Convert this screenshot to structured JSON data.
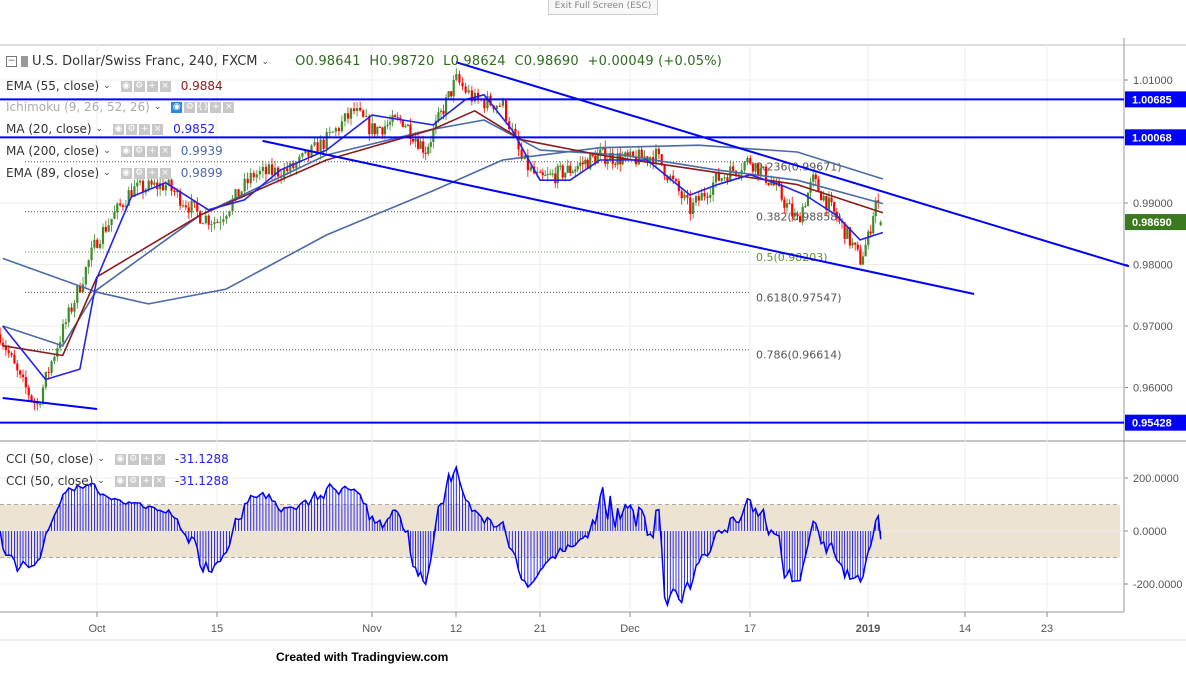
{
  "window": {
    "exit_fullscreen_label": "Exit Full Screen (ESC)"
  },
  "header": {
    "symbol_title": "U.S. Dollar/Swiss Franc, 240, FXCM",
    "open": "O0.98641",
    "high": "H0.98720",
    "low": "L0.98624",
    "close": "C0.98690",
    "change": "+0.00049 (+0.05%)"
  },
  "indicators": [
    {
      "label": "EMA (55, close)",
      "value": "0.9884",
      "color": "#8b1a1a"
    },
    {
      "label": "Ichimoku (9, 26, 52, 26)",
      "value": "",
      "color": "#999999",
      "hidden": true
    },
    {
      "label": "MA (20, close)",
      "value": "0.9852",
      "color": "#2222ee"
    },
    {
      "label": "MA (200, close)",
      "value": "0.9939",
      "color": "#4a6aa8"
    },
    {
      "label": "EMA (89, close)",
      "value": "0.9899",
      "color": "#4a6aa8"
    }
  ],
  "cci_indicators": [
    {
      "label": "CCI (50, close)",
      "value": "-31.1288"
    },
    {
      "label": "CCI (50, close)",
      "value": "-31.1288"
    }
  ],
  "footer": {
    "text": "Created with Tradingview.com"
  },
  "chart_data": {
    "type": "candlestick",
    "title": "U.S. Dollar/Swiss Franc, 240, FXCM",
    "ylim": [
      0.9529,
      1.0156
    ],
    "grid": true,
    "colors": {
      "up": "#3f8a2a",
      "down": "#ff0000",
      "hline": "#0000ff",
      "last_price": "#3a7a1e"
    },
    "last_bar": {
      "open": 0.98641,
      "high": 0.9872,
      "low": 0.98624,
      "close": 0.9869
    },
    "price_path": [
      [
        "2018-09-20",
        0.9677
      ],
      [
        "2018-09-22",
        0.9613
      ],
      [
        "2018-09-24",
        0.957
      ],
      [
        "2018-09-26",
        0.9655
      ],
      [
        "2018-10-01",
        0.984
      ],
      [
        "2018-10-05",
        0.9921
      ],
      [
        "2018-10-09",
        0.993
      ],
      [
        "2018-10-13",
        0.988
      ],
      [
        "2018-10-15",
        0.987
      ],
      [
        "2018-10-19",
        0.9946
      ],
      [
        "2018-10-23",
        0.9954
      ],
      [
        "2018-10-27",
        1.0002
      ],
      [
        "2018-10-30",
        1.005
      ],
      [
        "2018-11-01",
        1.0019
      ],
      [
        "2018-11-05",
        1.0035
      ],
      [
        "2018-11-08",
        0.9986
      ],
      [
        "2018-11-12",
        1.01
      ],
      [
        "2018-11-14",
        1.0067
      ],
      [
        "2018-11-17",
        1.006
      ],
      [
        "2018-11-19",
        0.997
      ],
      [
        "2018-11-21",
        0.9937
      ],
      [
        "2018-11-25",
        0.9954
      ],
      [
        "2018-11-29",
        0.9978
      ],
      [
        "2018-12-03",
        0.997
      ],
      [
        "2018-12-06",
        0.9978
      ],
      [
        "2018-12-10",
        0.9889
      ],
      [
        "2018-12-13",
        0.9937
      ],
      [
        "2018-12-17",
        0.997
      ],
      [
        "2018-12-20",
        0.9929
      ],
      [
        "2018-12-23",
        0.987
      ],
      [
        "2018-12-25",
        0.9937
      ],
      [
        "2018-12-29",
        0.9856
      ],
      [
        "2018-12-31",
        0.9807
      ],
      [
        "2019-01-01",
        0.984
      ],
      [
        "2019-01-02",
        0.9905
      ],
      [
        "2019-01-03",
        0.9869
      ]
    ],
    "series": [
      {
        "name": "MA (200, close)",
        "color": "#4a6aa8",
        "points": [
          [
            "2018-09-20",
            0.981
          ],
          [
            "2018-10-01",
            0.9755
          ],
          [
            "2018-10-07",
            0.9736
          ],
          [
            "2018-10-16",
            0.976
          ],
          [
            "2018-10-27",
            0.9848
          ],
          [
            "2018-11-09",
            0.992
          ],
          [
            "2018-11-17",
            0.997
          ],
          [
            "2018-11-29",
            0.999
          ],
          [
            "2018-12-11",
            0.9994
          ],
          [
            "2018-12-23",
            0.9983
          ],
          [
            "2019-01-03",
            0.9939
          ]
        ]
      },
      {
        "name": "EMA (89, close)",
        "color": "#4a6aa8",
        "points": [
          [
            "2018-09-20",
            0.97
          ],
          [
            "2018-09-27",
            0.9668
          ],
          [
            "2018-10-01",
            0.9759
          ],
          [
            "2018-10-13",
            0.988
          ],
          [
            "2018-10-27",
            0.9978
          ],
          [
            "2018-11-09",
            1.002
          ],
          [
            "2018-11-15",
            1.0035
          ],
          [
            "2018-11-21",
            0.9986
          ],
          [
            "2018-12-02",
            0.9978
          ],
          [
            "2018-12-13",
            0.9954
          ],
          [
            "2018-12-23",
            0.9937
          ],
          [
            "2019-01-03",
            0.9899
          ]
        ]
      },
      {
        "name": "EMA (55, close)",
        "color": "#8b1a1a",
        "points": [
          [
            "2018-09-20",
            0.9668
          ],
          [
            "2018-09-27",
            0.9652
          ],
          [
            "2018-10-01",
            0.978
          ],
          [
            "2018-10-13",
            0.988
          ],
          [
            "2018-10-27",
            0.997
          ],
          [
            "2018-11-09",
            1.002
          ],
          [
            "2018-11-14",
            1.005
          ],
          [
            "2018-11-19",
            1.0003
          ],
          [
            "2018-11-29",
            0.9978
          ],
          [
            "2018-12-11",
            0.9954
          ],
          [
            "2018-12-23",
            0.993
          ],
          [
            "2019-01-03",
            0.9884
          ]
        ]
      },
      {
        "name": "MA (20, close)",
        "color": "#2222ee",
        "points": [
          [
            "2018-09-20",
            0.97
          ],
          [
            "2018-09-25",
            0.9613
          ],
          [
            "2018-09-29",
            0.963
          ],
          [
            "2018-10-01",
            0.9778
          ],
          [
            "2018-10-05",
            0.991
          ],
          [
            "2018-10-09",
            0.9933
          ],
          [
            "2018-10-14",
            0.9889
          ],
          [
            "2018-10-18",
            0.9905
          ],
          [
            "2018-10-22",
            0.9954
          ],
          [
            "2018-10-27",
            0.9986
          ],
          [
            "2018-11-01",
            1.0043
          ],
          [
            "2018-11-05",
            1.0035
          ],
          [
            "2018-11-09",
            1.0027
          ],
          [
            "2018-11-13",
            1.0068
          ],
          [
            "2018-11-15",
            1.0076
          ],
          [
            "2018-11-18",
            1.0019
          ],
          [
            "2018-11-21",
            0.9937
          ],
          [
            "2018-11-25",
            0.9937
          ],
          [
            "2018-11-29",
            0.997
          ],
          [
            "2018-12-05",
            0.997
          ],
          [
            "2018-12-10",
            0.9913
          ],
          [
            "2018-12-13",
            0.9929
          ],
          [
            "2018-12-17",
            0.9946
          ],
          [
            "2018-12-21",
            0.9929
          ],
          [
            "2018-12-24",
            0.9913
          ],
          [
            "2018-12-28",
            0.988
          ],
          [
            "2018-12-31",
            0.984
          ],
          [
            "2019-01-03",
            0.9852
          ]
        ]
      }
    ],
    "horizontal_lines": [
      1.00685,
      1.00068,
      0.95428
    ],
    "trendlines": [
      [
        [
          "2018-11-12",
          1.0129
        ],
        [
          "2019-02-01",
          0.9797
        ]
      ],
      [
        [
          "2018-10-20",
          1.0001
        ],
        [
          "2019-01-15",
          0.9752
        ]
      ],
      [
        [
          "2018-09-20",
          0.9583
        ],
        [
          "2018-10-01",
          0.9565
        ]
      ]
    ],
    "fibonacci": [
      {
        "label": "0.236(0.99671)",
        "price": 0.99671,
        "color": "#555555"
      },
      {
        "label": "0.382(0.98858)",
        "price": 0.98858,
        "color": "#555555"
      },
      {
        "label": "0.5(0.98203)",
        "price": 0.98203,
        "color": "#5f8f35"
      },
      {
        "label": "0.618(0.97547)",
        "price": 0.97547,
        "color": "#555555"
      },
      {
        "label": "0.786(0.96614)",
        "price": 0.96614,
        "color": "#555555"
      }
    ],
    "price_ticks": [
      "1.01000",
      "0.99000",
      "0.98000",
      "0.97000",
      "0.96000"
    ],
    "price_tags": [
      {
        "label": "1.00685",
        "price": 1.00685,
        "color": "#0000ff"
      },
      {
        "label": "1.00068",
        "price": 1.00068,
        "color": "#0000ff"
      },
      {
        "label": "0.98690",
        "price": 0.9869,
        "color": "#3a7a1e"
      },
      {
        "label": "0.95428",
        "price": 0.95428,
        "color": "#0000ff"
      }
    ],
    "time_ticks": [
      {
        "label": "Oct",
        "date": "2018-10-01"
      },
      {
        "label": "15",
        "date": "2018-10-15"
      },
      {
        "label": "Nov",
        "date": "2018-11-01"
      },
      {
        "label": "12",
        "date": "2018-11-12"
      },
      {
        "label": "21",
        "date": "2018-11-21"
      },
      {
        "label": "Dec",
        "date": "2018-12-03"
      },
      {
        "label": "17",
        "date": "2018-12-17"
      },
      {
        "label": "2019",
        "date": "2019-01-01",
        "bold": true
      },
      {
        "label": "14",
        "date": "2019-01-14"
      },
      {
        "label": "23",
        "date": "2019-01-23"
      }
    ],
    "cci": {
      "ylim": [
        -298,
        336
      ],
      "band": [
        -100,
        100
      ],
      "ticks": [
        "200.0000",
        "0.0000",
        "-200.0000"
      ],
      "tick_values": [
        200,
        0,
        -200
      ],
      "color": "#0000ff",
      "band_color": "#ece3d3"
    }
  }
}
